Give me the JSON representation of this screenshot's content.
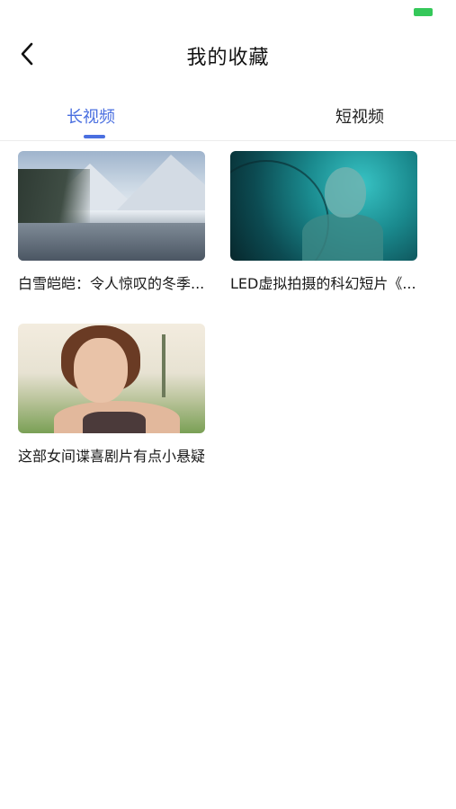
{
  "header": {
    "title": "我的收藏",
    "back_icon": "chevron-left-icon"
  },
  "status_bar": {
    "battery_color": "#35c85a"
  },
  "tabs": [
    {
      "label": "长视频",
      "active": true
    },
    {
      "label": "短视频",
      "active": false
    }
  ],
  "accent_color": "#4a6fe0",
  "items": [
    {
      "title": "白雪皑皑：令人惊叹的冬季...",
      "thumbnail": "snowy-mountain-lake"
    },
    {
      "title": "LED虚拟拍摄的科幻短片《...",
      "thumbnail": "teal-sci-fi-figure"
    },
    {
      "title": "这部女间谍喜剧片有点小悬疑",
      "thumbnail": "woman-portrait-outdoors"
    }
  ]
}
